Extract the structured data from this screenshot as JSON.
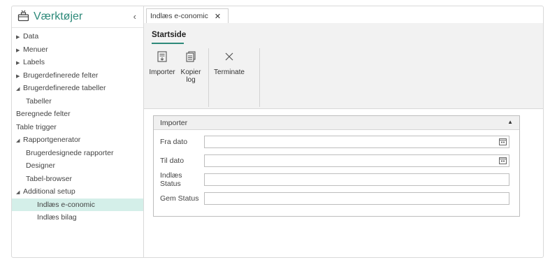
{
  "sidebar": {
    "title": "Værktøjer",
    "collapse_glyph": "‹",
    "items": [
      {
        "label": "Data",
        "indent": 0,
        "arrow": "▶"
      },
      {
        "label": "Menuer",
        "indent": 0,
        "arrow": "▶"
      },
      {
        "label": "Labels",
        "indent": 0,
        "arrow": "▶"
      },
      {
        "label": "Brugerdefinerede felter",
        "indent": 0,
        "arrow": "▶"
      },
      {
        "label": "Brugerdefinerede tabeller",
        "indent": 0,
        "arrow": "◢"
      },
      {
        "label": "Tabeller",
        "indent": 1,
        "arrow": ""
      },
      {
        "label": "Beregnede felter",
        "indent": 0,
        "arrow": ""
      },
      {
        "label": "Table trigger",
        "indent": 0,
        "arrow": ""
      },
      {
        "label": "Rapportgenerator",
        "indent": 0,
        "arrow": "◢"
      },
      {
        "label": "Brugerdesignede rapporter",
        "indent": 1,
        "arrow": ""
      },
      {
        "label": "Designer",
        "indent": 1,
        "arrow": ""
      },
      {
        "label": "Tabel-browser",
        "indent": 1,
        "arrow": ""
      },
      {
        "label": "Additional setup",
        "indent": 0,
        "arrow": "◢"
      },
      {
        "label": "Indlæs e-conomic",
        "indent": 2,
        "arrow": "",
        "selected": true
      },
      {
        "label": "Indlæs bilag",
        "indent": 2,
        "arrow": ""
      }
    ]
  },
  "tab": {
    "label": "Indlæs e-conomic",
    "close": "✕"
  },
  "ribbon": {
    "tab_label": "Startside",
    "buttons": {
      "importer": "Importer",
      "kopier_line1": "Kopier",
      "kopier_line2": "log",
      "terminate": "Terminate"
    }
  },
  "group": {
    "title": "Importer",
    "caret": "▲",
    "fields": [
      {
        "label": "Fra dato",
        "value": "",
        "calendar": true
      },
      {
        "label": "Til dato",
        "value": "",
        "calendar": true
      },
      {
        "label": "Indlæs Status",
        "value": "",
        "calendar": false
      },
      {
        "label": "Gem Status",
        "value": "",
        "calendar": false
      }
    ]
  },
  "colors": {
    "accent": "#2e8a7a",
    "selected_bg": "#d4efe9"
  }
}
